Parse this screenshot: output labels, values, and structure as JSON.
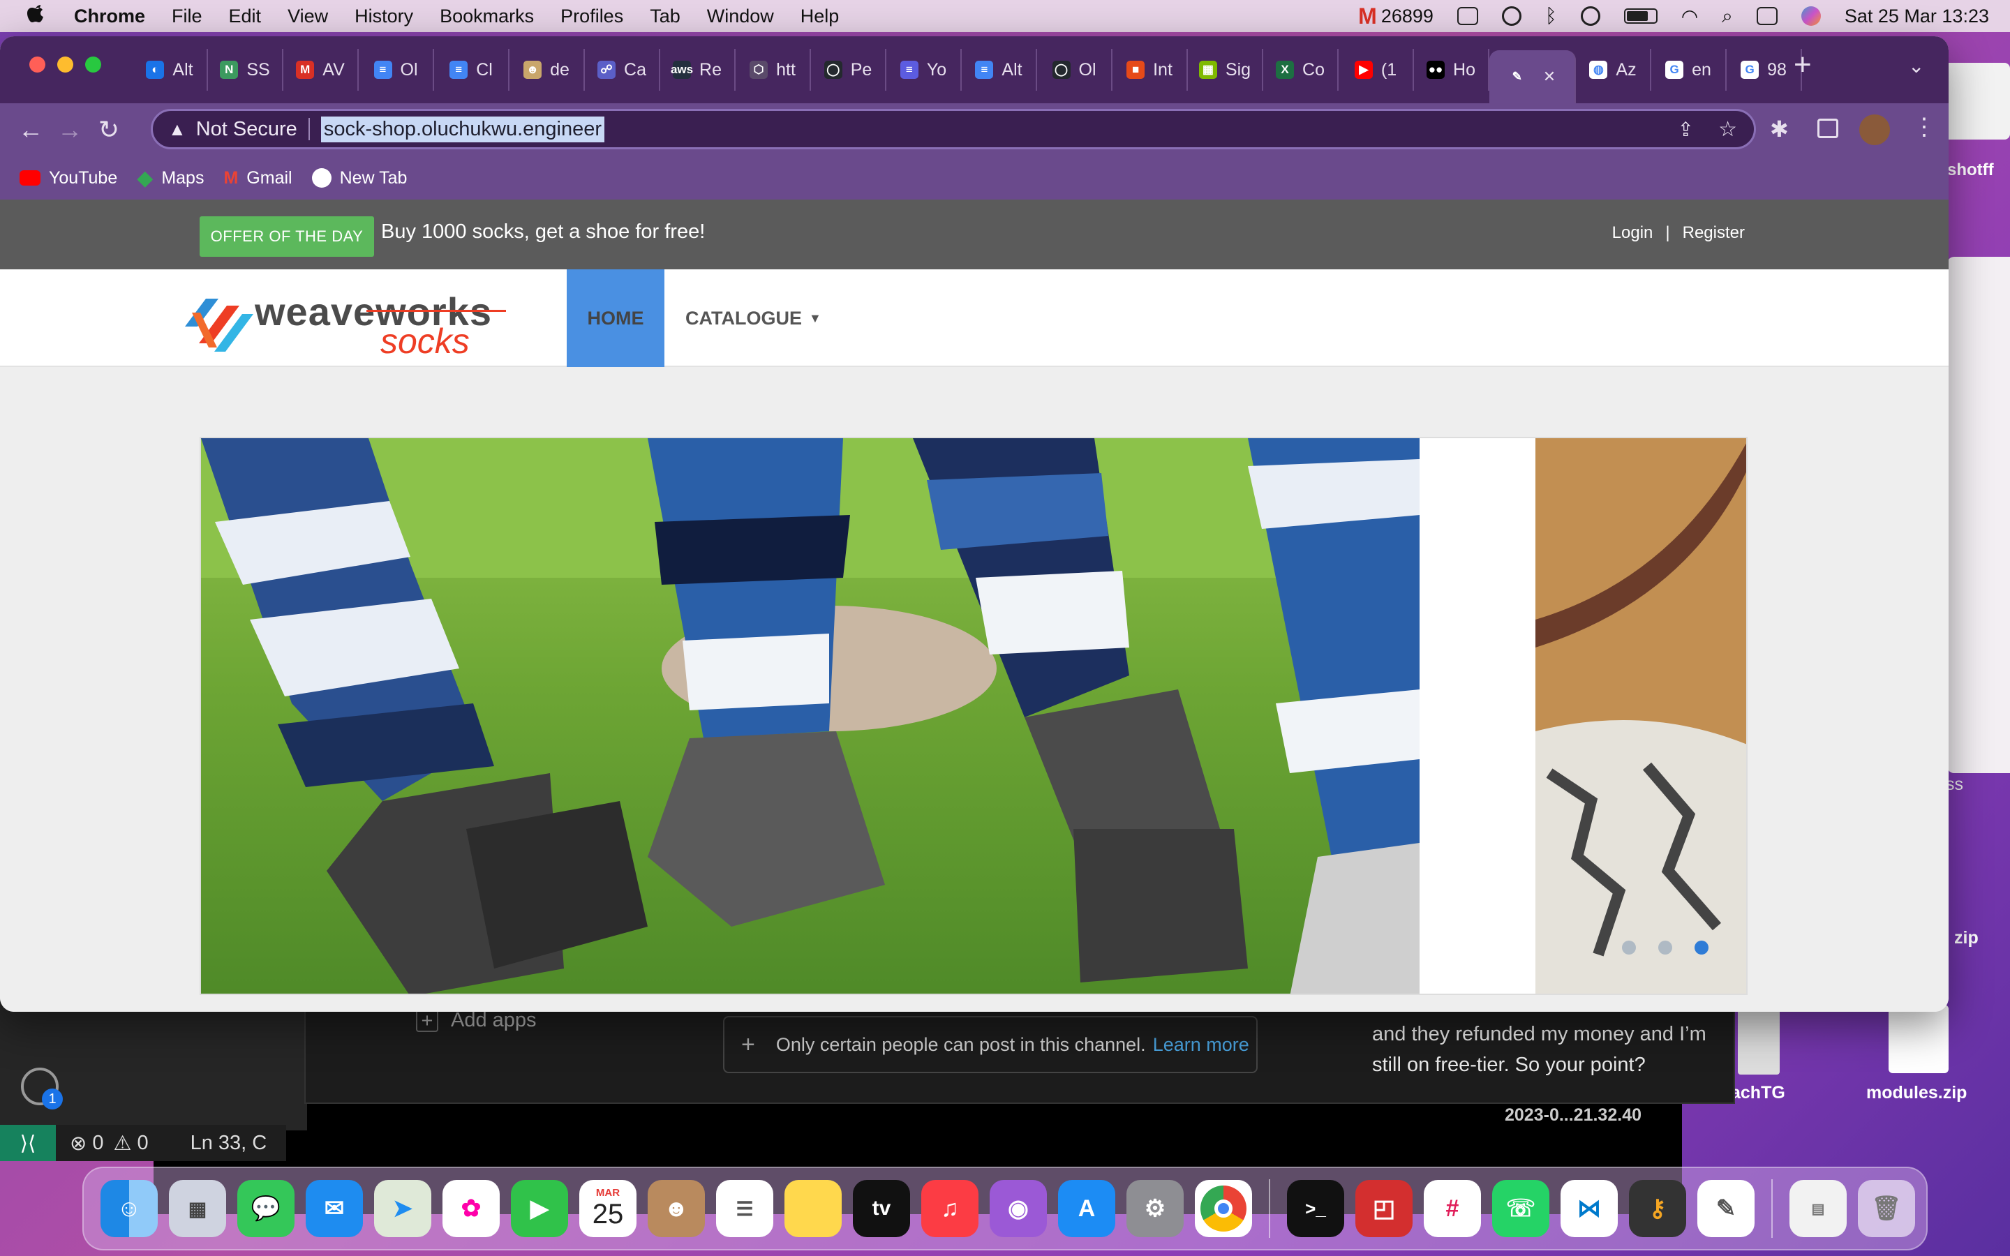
{
  "menubar": {
    "apple": "",
    "items": [
      "Chrome",
      "File",
      "Edit",
      "View",
      "History",
      "Bookmarks",
      "Profiles",
      "Tab",
      "Window",
      "Help"
    ],
    "gmail_count": "26899",
    "datetime": "Sat 25 Mar  13:23"
  },
  "browser": {
    "tabs": [
      {
        "label": "Alt",
        "color": "#1a73e8",
        "glyph": "◐"
      },
      {
        "label": "SS",
        "color": "#3c9a5f",
        "glyph": "N"
      },
      {
        "label": "AV",
        "color": "#d93025",
        "glyph": "M"
      },
      {
        "label": "Ol",
        "color": "#4285f4",
        "glyph": "≡"
      },
      {
        "label": "Cl",
        "color": "#4285f4",
        "glyph": "≡"
      },
      {
        "label": "de",
        "color": "#c9a66b",
        "glyph": "☻"
      },
      {
        "label": "Ca",
        "color": "#5b5fc7",
        "glyph": "☍"
      },
      {
        "label": "Re",
        "color": "#232f3e",
        "glyph": "aws"
      },
      {
        "label": "htt",
        "color": "#5a4a6a",
        "glyph": "⬡"
      },
      {
        "label": "Pe",
        "color": "#24292e",
        "glyph": "◯"
      },
      {
        "label": "Yo",
        "color": "#5c5ce0",
        "glyph": "≡"
      },
      {
        "label": "Alt",
        "color": "#4285f4",
        "glyph": "≡"
      },
      {
        "label": "Ol",
        "color": "#24292e",
        "glyph": "◯"
      },
      {
        "label": "Int",
        "color": "#e64a19",
        "glyph": "■"
      },
      {
        "label": "Sig",
        "color": "#7fba00",
        "glyph": "▦"
      },
      {
        "label": "Co",
        "color": "#1d6f42",
        "glyph": "X"
      },
      {
        "label": "(1",
        "color": "#ff0000",
        "glyph": "▶"
      },
      {
        "label": "Ho",
        "color": "#000000",
        "glyph": "●●"
      },
      {
        "label": "",
        "color": "#6a4a8c",
        "glyph": "✎",
        "active": true
      },
      {
        "label": "Az",
        "color": "#ffffff",
        "glyph": "◍"
      },
      {
        "label": "en",
        "color": "#ffffff",
        "glyph": "G"
      },
      {
        "label": "98",
        "color": "#ffffff",
        "glyph": "G"
      }
    ],
    "address": {
      "security": "Not Secure",
      "url": "sock-shop.oluchukwu.engineer"
    },
    "bookmarks": [
      {
        "label": "YouTube",
        "color": "#ff0000"
      },
      {
        "label": "Maps",
        "color": "#34a853"
      },
      {
        "label": "Gmail",
        "color": "#ea4335"
      },
      {
        "label": "New Tab",
        "color": "#ffffff"
      }
    ]
  },
  "site": {
    "offer_badge": "OFFER OF THE DAY",
    "offer_text": "Buy 1000 socks, get a shoe for free!",
    "login": "Login",
    "separator": "|",
    "register": "Register",
    "logo_top": "weaveworks",
    "logo_bottom": "socks",
    "nav_home": "HOME",
    "nav_catalogue": "CATALOGUE",
    "carousel_index": 3,
    "carousel_count": 3
  },
  "background": {
    "add_apps": "Add apps",
    "post_notice": "Only certain people can post in this channel.",
    "learn_more": "Learn more",
    "chat_text": "and they refunded my money and I’m still on free-tier.  So your point?",
    "status": {
      "errors": "0",
      "warnings": "0",
      "position": "Ln 33, C"
    },
    "settings_badge": "1",
    "desktop_files": [
      {
        "label": "shotff"
      },
      {
        "label": "achTG"
      },
      {
        "label": "modules.zip"
      },
      {
        "label": "2023-0...21.32.40"
      },
      {
        "label": "zip"
      },
      {
        "label": "ss"
      }
    ]
  },
  "dock": {
    "calendar_month": "MAR",
    "calendar_day": "25",
    "apps": [
      "Finder",
      "Launchpad",
      "Messages",
      "Mail",
      "Maps",
      "Photos",
      "FaceTime",
      "Calendar",
      "Contacts",
      "Reminders",
      "Notes",
      "TV",
      "Music",
      "Podcasts",
      "App Store",
      "System Settings",
      "Chrome",
      "Terminal",
      "Screenshot",
      "Slack",
      "WhatsApp",
      "VS Code",
      "Keychain",
      "TextEdit",
      "Document",
      "Trash"
    ]
  },
  "colors": {
    "accent": "#4a90e2",
    "offer": "#5cb85c",
    "chrome_frame": "#46265f"
  }
}
